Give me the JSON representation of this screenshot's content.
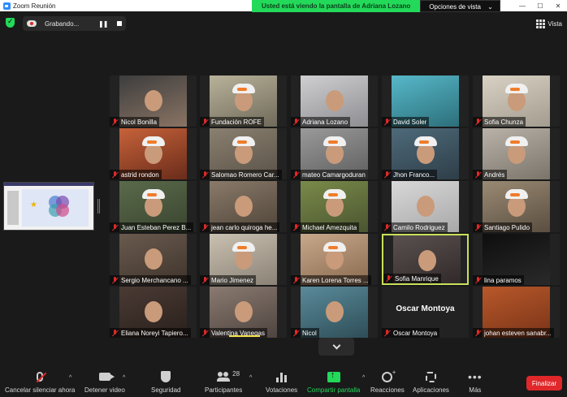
{
  "window": {
    "title": "Zoom Reunión",
    "minimize": "—",
    "maximize": "☐",
    "close": "✕"
  },
  "share_banner": {
    "message": "Usted está viendo la pantalla de Adriana Lozano",
    "options_label": "Opciones de vista",
    "options_caret": "⌄"
  },
  "recording": {
    "label": "Grabando...",
    "pause": "❚❚"
  },
  "view_button": {
    "label": "Vista"
  },
  "participants_tiles": [
    {
      "name": "Nicol Bonilla"
    },
    {
      "name": "Fundación ROFE"
    },
    {
      "name": "Adriana Lozano"
    },
    {
      "name": "David Soler"
    },
    {
      "name": "Sofia Chunza"
    },
    {
      "name": "astrid rondon"
    },
    {
      "name": "Salomao Romero Car..."
    },
    {
      "name": "mateo Camargoduran"
    },
    {
      "name": "Jhon Franco..."
    },
    {
      "name": "Andrés"
    },
    {
      "name": "Juan Esteban Perez B..."
    },
    {
      "name": "jean carlo quiroga he..."
    },
    {
      "name": "Michael Amezquita"
    },
    {
      "name": "Camilo Rodriguez"
    },
    {
      "name": "Santiago Pulido"
    },
    {
      "name": "Sergio Merchancano ..."
    },
    {
      "name": "Mario Jimenez"
    },
    {
      "name": "Karen Lorena Torres ..."
    },
    {
      "name": "Sofia Manrique"
    },
    {
      "name": "lina paramos"
    },
    {
      "name": "Eliana Noreyi Tapiero..."
    },
    {
      "name": "Valentina Vanegas"
    },
    {
      "name": "Nicol"
    },
    {
      "name": "Oscar Montoya",
      "big_name": "Oscar Montoya"
    },
    {
      "name": "johan esteven sanabr..."
    }
  ],
  "toolbar": {
    "mute": "Cancelar silenciar ahora",
    "video": "Detener video",
    "security": "Seguridad",
    "participants": "Participantes",
    "participants_count": "28",
    "polls": "Votaciones",
    "share": "Compartir pantalla",
    "reactions": "Reacciones",
    "apps": "Aplicaciones",
    "more": "Más",
    "more_glyph": "•••",
    "end": "Finalizar",
    "caret": "^"
  },
  "colors": {
    "accent_green": "#23d959",
    "end_red": "#e0282a",
    "active_speaker": "#c8e05a",
    "background": "#1a1a1a"
  }
}
